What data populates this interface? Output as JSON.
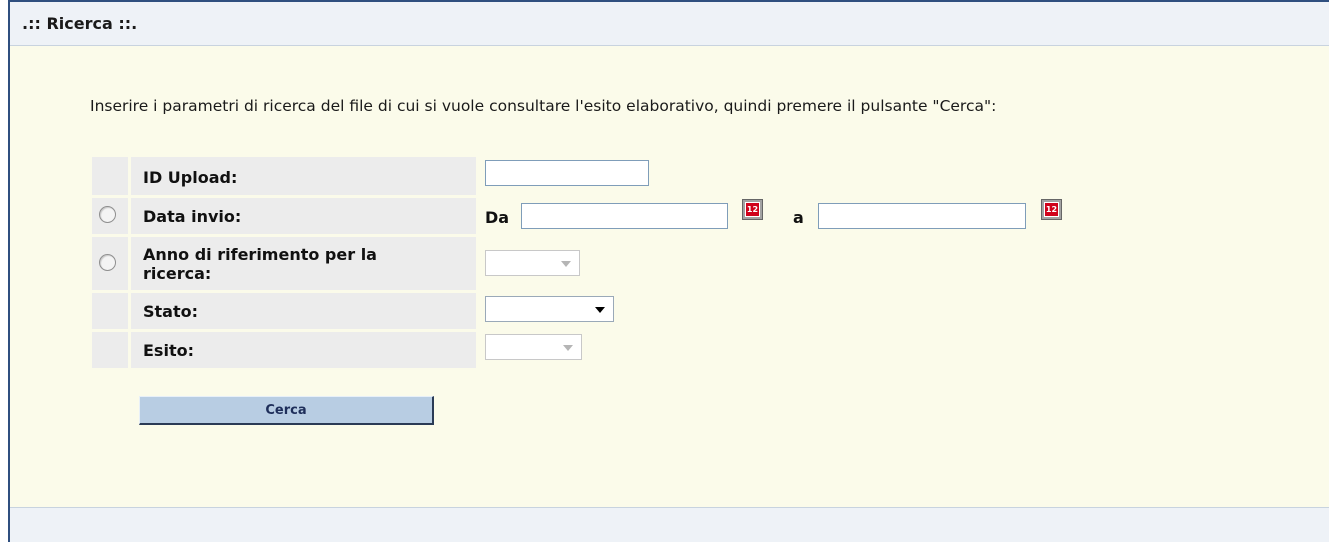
{
  "panel": {
    "title": ".:: Ricerca ::."
  },
  "instructions": "Inserire i parametri di ricerca del file di cui si vuole consultare l'esito elaborativo, quindi premere il pulsante \"Cerca\":",
  "form": {
    "id_upload": {
      "label": "ID Upload:",
      "value": ""
    },
    "data_invio": {
      "label": "Data invio:",
      "from_prefix": "Da",
      "from_value": "",
      "to_prefix": "a",
      "to_value": "",
      "radio_selected": false
    },
    "anno": {
      "label_line1": "Anno di riferimento per la",
      "label_line2": "ricerca:",
      "value": "",
      "disabled": true,
      "radio_selected": false
    },
    "stato": {
      "label": "Stato:",
      "value": "",
      "disabled": false
    },
    "esito": {
      "label": "Esito:",
      "value": "",
      "disabled": true
    }
  },
  "search_button": {
    "label": "Cerca"
  },
  "icons": {
    "calendar": "calendar-icon",
    "dropdown": "chevron-down-icon"
  },
  "colors": {
    "panel_background": "#fbfbea",
    "header_background": "#eef2f7",
    "border": "#2f4f7f",
    "button_background": "#b8cde3",
    "button_text": "#1e2e5a",
    "row_background": "#ececec",
    "calendar_red": "#d0021b"
  }
}
